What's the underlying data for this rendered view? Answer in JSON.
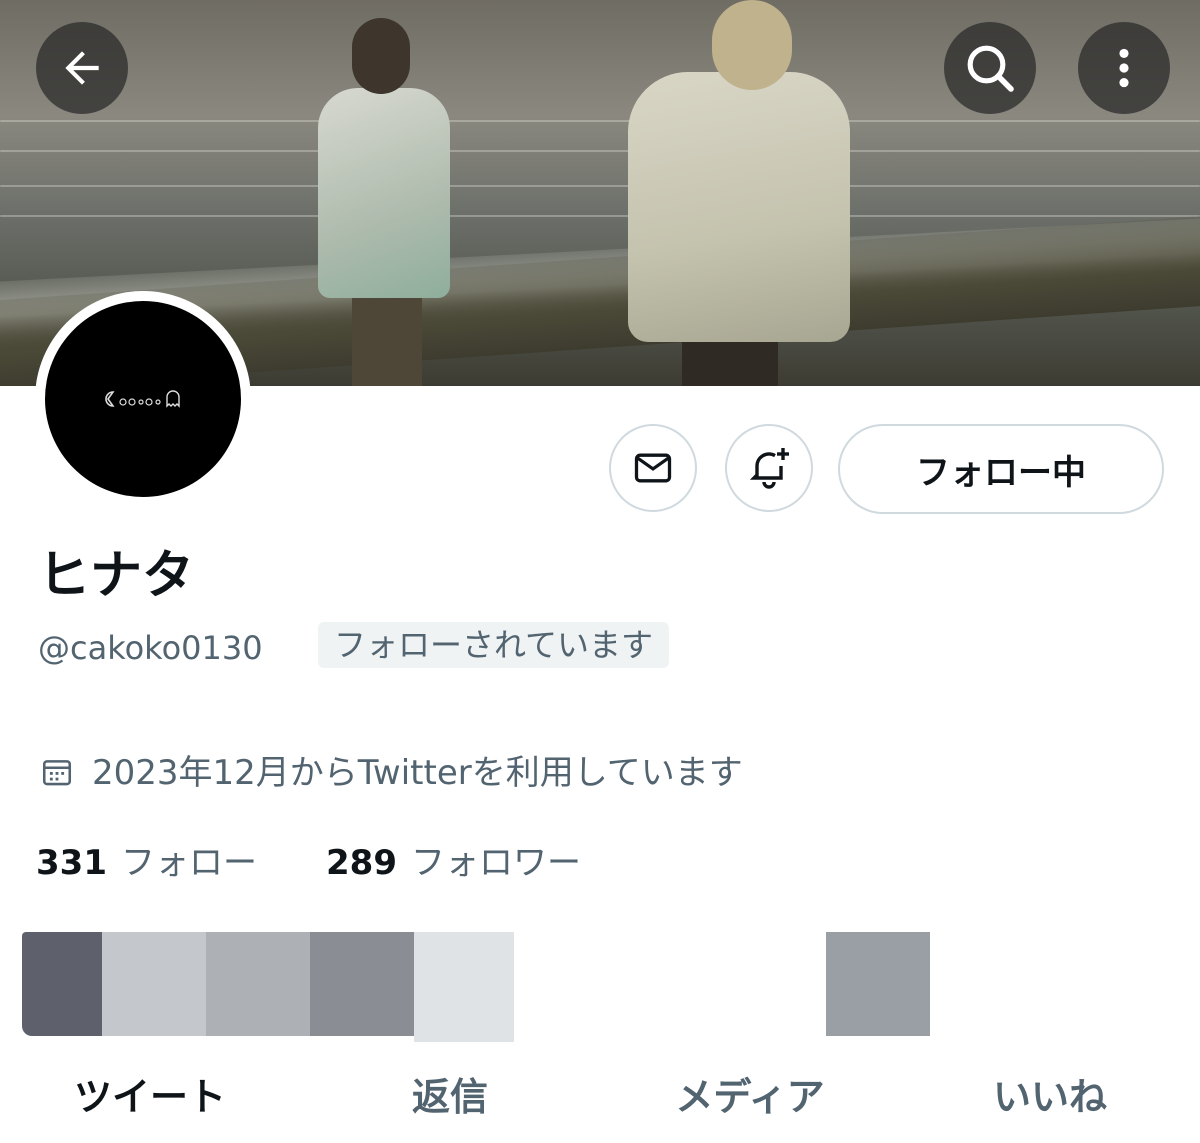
{
  "header": {
    "back_icon": "arrow-left-icon",
    "search_icon": "search-icon",
    "more_icon": "more-vertical-icon"
  },
  "avatar": {
    "label": "Cookie ghost pixel logo"
  },
  "actions": {
    "message_icon": "mail-icon",
    "notify_icon": "bell-plus-icon",
    "follow_label": "フォロー中"
  },
  "profile": {
    "name": "ヒナタ",
    "handle": "@cakoko0130",
    "follows_you": "フォローされています",
    "joined": "2023年12月からTwitterを利用しています",
    "following_count": "331",
    "following_label": "フォロー",
    "followers_count": "289",
    "followers_label": "フォロワー"
  },
  "tabs": [
    {
      "label": "ツイート",
      "active": true
    },
    {
      "label": "返信",
      "active": false
    },
    {
      "label": "メディア",
      "active": false
    },
    {
      "label": "いいね",
      "active": false
    }
  ],
  "colors": {
    "primary_text": "#0f1419",
    "secondary_text": "#536471",
    "border": "#cfd9de",
    "badge_bg": "#eff3f4"
  }
}
